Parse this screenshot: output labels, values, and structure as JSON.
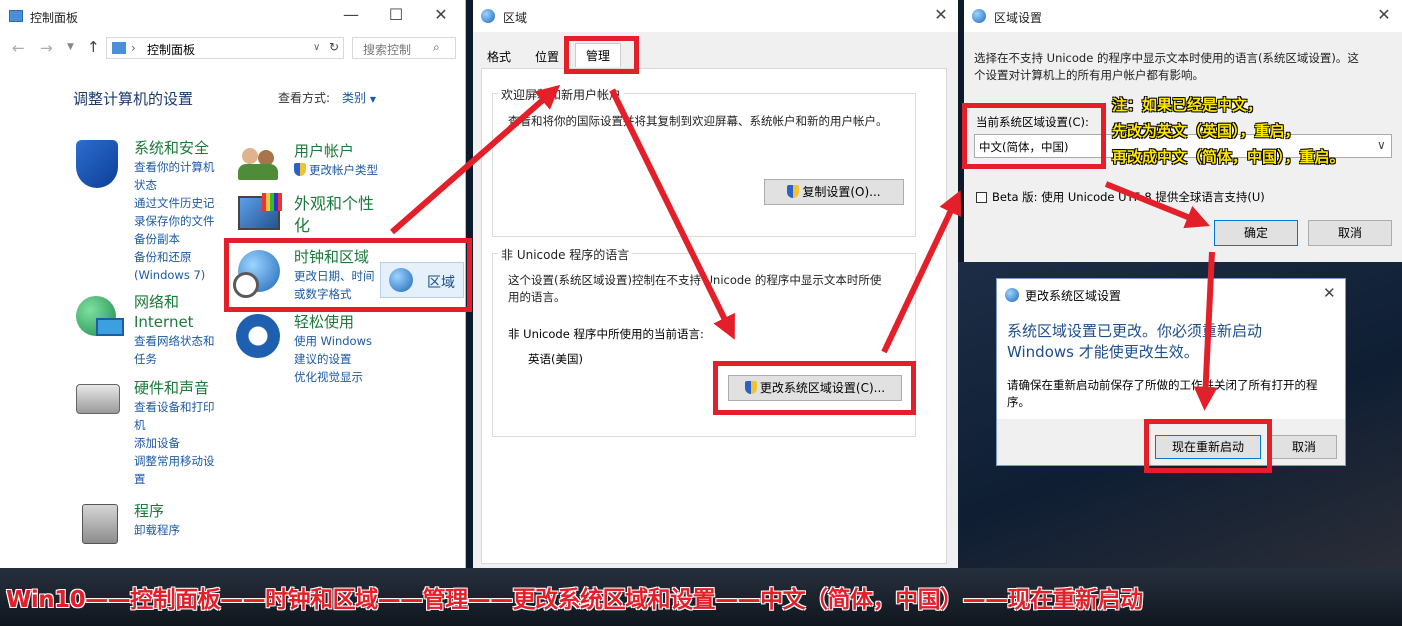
{
  "control_panel": {
    "title": "控制面板",
    "address": "控制面板",
    "search_placeholder": "搜索控制",
    "heading": "调整计算机的设置",
    "view_label": "查看方式:",
    "view_value": "类别",
    "categories": {
      "security": {
        "name": "系统和安全",
        "links": [
          "查看你的计算机",
          "状态",
          "通过文件历史记",
          "录保存你的文件",
          "备份副本",
          "备份和还原",
          "(Windows 7)"
        ]
      },
      "network": {
        "name1": "网络和",
        "name2": "Internet",
        "links": [
          "查看网络状态和",
          "任务"
        ]
      },
      "hardware": {
        "name": "硬件和声音",
        "links": [
          "查看设备和打印",
          "机",
          "添加设备",
          "调整常用移动设",
          "置"
        ]
      },
      "programs": {
        "name": "程序",
        "links": [
          "卸载程序"
        ]
      },
      "accounts": {
        "name": "用户帐户",
        "links": [
          "更改帐户类型"
        ]
      },
      "appearance": {
        "name1": "外观和个性",
        "name2": "化"
      },
      "clock": {
        "name": "时钟和区域",
        "links": [
          "更改日期、时间",
          "或数字格式"
        ],
        "popup": "区域"
      },
      "ease": {
        "name": "轻松使用",
        "links": [
          "使用 Windows",
          "建议的设置",
          "优化视觉显示"
        ]
      }
    }
  },
  "region": {
    "title": "区域",
    "tabs": [
      "格式",
      "位置",
      "管理"
    ],
    "welcome_title": "欢迎屏幕和新用户帐户",
    "welcome_desc": "查看和将你的国际设置并将其复制到欢迎屏幕、系统帐户和新的用户帐户。",
    "copy_button": "复制设置(O)...",
    "nonunicode_title": "非 Unicode 程序的语言",
    "nonunicode_desc1": "这个设置(系统区域设置)控制在不支持 Unicode 的程序中显示文本时所使",
    "nonunicode_desc2": "用的语言。",
    "current_label": "非 Unicode 程序中所使用的当前语言:",
    "current_value": "英语(美国)",
    "change_button": "更改系统区域设置(C)..."
  },
  "region_settings": {
    "title": "区域设置",
    "desc1": "选择在不支持 Unicode 的程序中显示文本时使用的语言(系统区域设置)。这",
    "desc2": "个设置对计算机上的所有用户帐户都有影响。",
    "current_label": "当前系统区域设置(C):",
    "current_value": "中文(简体，中国)",
    "beta_label": "Beta 版: 使用 Unicode UTF-8 提供全球语言支持(U)",
    "ok": "确定",
    "cancel": "取消"
  },
  "note": {
    "line1": "注：如果已经是中文，",
    "line2": "先改为英文（英国），重启，",
    "line3": "再改成中文（简体，中国），重启。"
  },
  "restart_dialog": {
    "title": "更改系统区域设置",
    "main1": "系统区域设置已更改。你必须重新启动",
    "main2": "Windows 才能使更改生效。",
    "sub1": "请确保在重新启动前保存了所做的工作并关闭了所有打开的程",
    "sub2": "序。",
    "restart": "现在重新启动",
    "cancel": "取消"
  },
  "banner": "Win10——控制面板——时钟和区域——管理——更改系统区域和设置——中文（简体，中国）——现在重新启动",
  "colors": {
    "red": "#e3202a",
    "yellow": "#ffe600",
    "link": "#1c5aa6",
    "category": "#1a7a3a"
  }
}
